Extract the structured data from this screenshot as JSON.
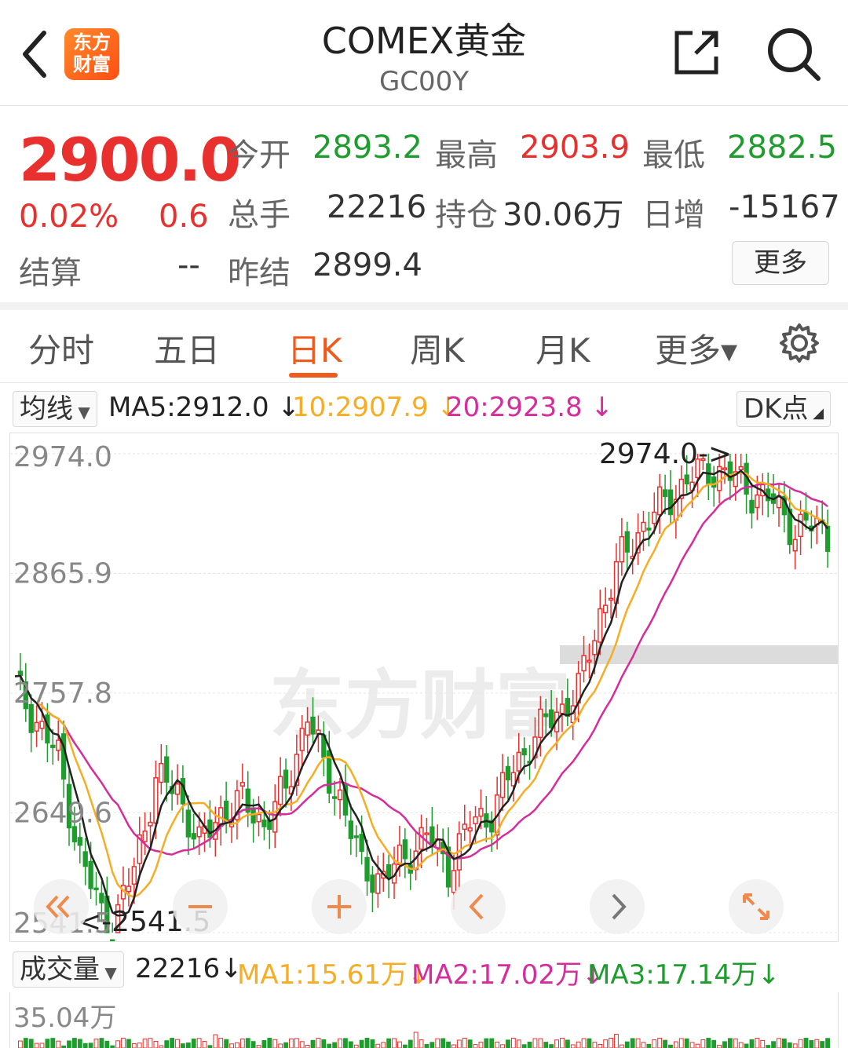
{
  "header": {
    "title": "COMEX黄金",
    "code": "GC00Y",
    "logo_text_line1": "东方",
    "logo_text_line2": "财富"
  },
  "quote": {
    "price": "2900.0",
    "change_pct": "0.02%",
    "change": "0.6",
    "settle_label": "结算",
    "settle_value": "--",
    "open_label": "今开",
    "open_value": "2893.2",
    "high_label": "最高",
    "high_value": "2903.9",
    "low_label": "最低",
    "low_value": "2882.5",
    "volume_label": "总手",
    "volume_value": "22216",
    "oi_label": "持仓",
    "oi_value": "30.06万",
    "daily_inc_label": "日增",
    "daily_inc_value": "-15167",
    "prev_settle_label": "昨结",
    "prev_settle_value": "2899.4",
    "more_label": "更多"
  },
  "tabs": [
    {
      "label": "分时"
    },
    {
      "label": "五日"
    },
    {
      "label": "日K",
      "active": true
    },
    {
      "label": "周K"
    },
    {
      "label": "月K"
    },
    {
      "label": "更多▾"
    }
  ],
  "ma_row": {
    "selector": "均线",
    "ma5": "MA5:2912.0 ↓",
    "ma10": "10:2907.9 ↓",
    "ma20": "20:2923.8 ↓",
    "dk_label": "DK点"
  },
  "colors": {
    "up": "#e8312f",
    "down": "#1e9d2e",
    "accent": "#ef5a1d",
    "ma5": "#222222",
    "ma10": "#f6ad24",
    "ma20": "#d62c9c"
  },
  "chart_data": {
    "type": "candlestick",
    "y_ticks": [
      "2974.0",
      "2865.9",
      "2757.8",
      "2649.6",
      "2541.5"
    ],
    "ylim": [
      2541.5,
      2974.0
    ],
    "max_label": "2974.0->",
    "min_label": "<-2541.5",
    "watermark": "东方财富"
  },
  "volume_row": {
    "selector": "成交量",
    "value": "22216↓",
    "ma1": "MA1:15.61万↓",
    "ma2": "MA2:17.02万↓",
    "ma3": "MA3:17.14万↓",
    "axis_max": "35.04万"
  },
  "controls": [
    "rewind-icon",
    "zoom-out-icon",
    "zoom-in-icon",
    "prev-icon",
    "next-icon",
    "fullscreen-icon"
  ]
}
